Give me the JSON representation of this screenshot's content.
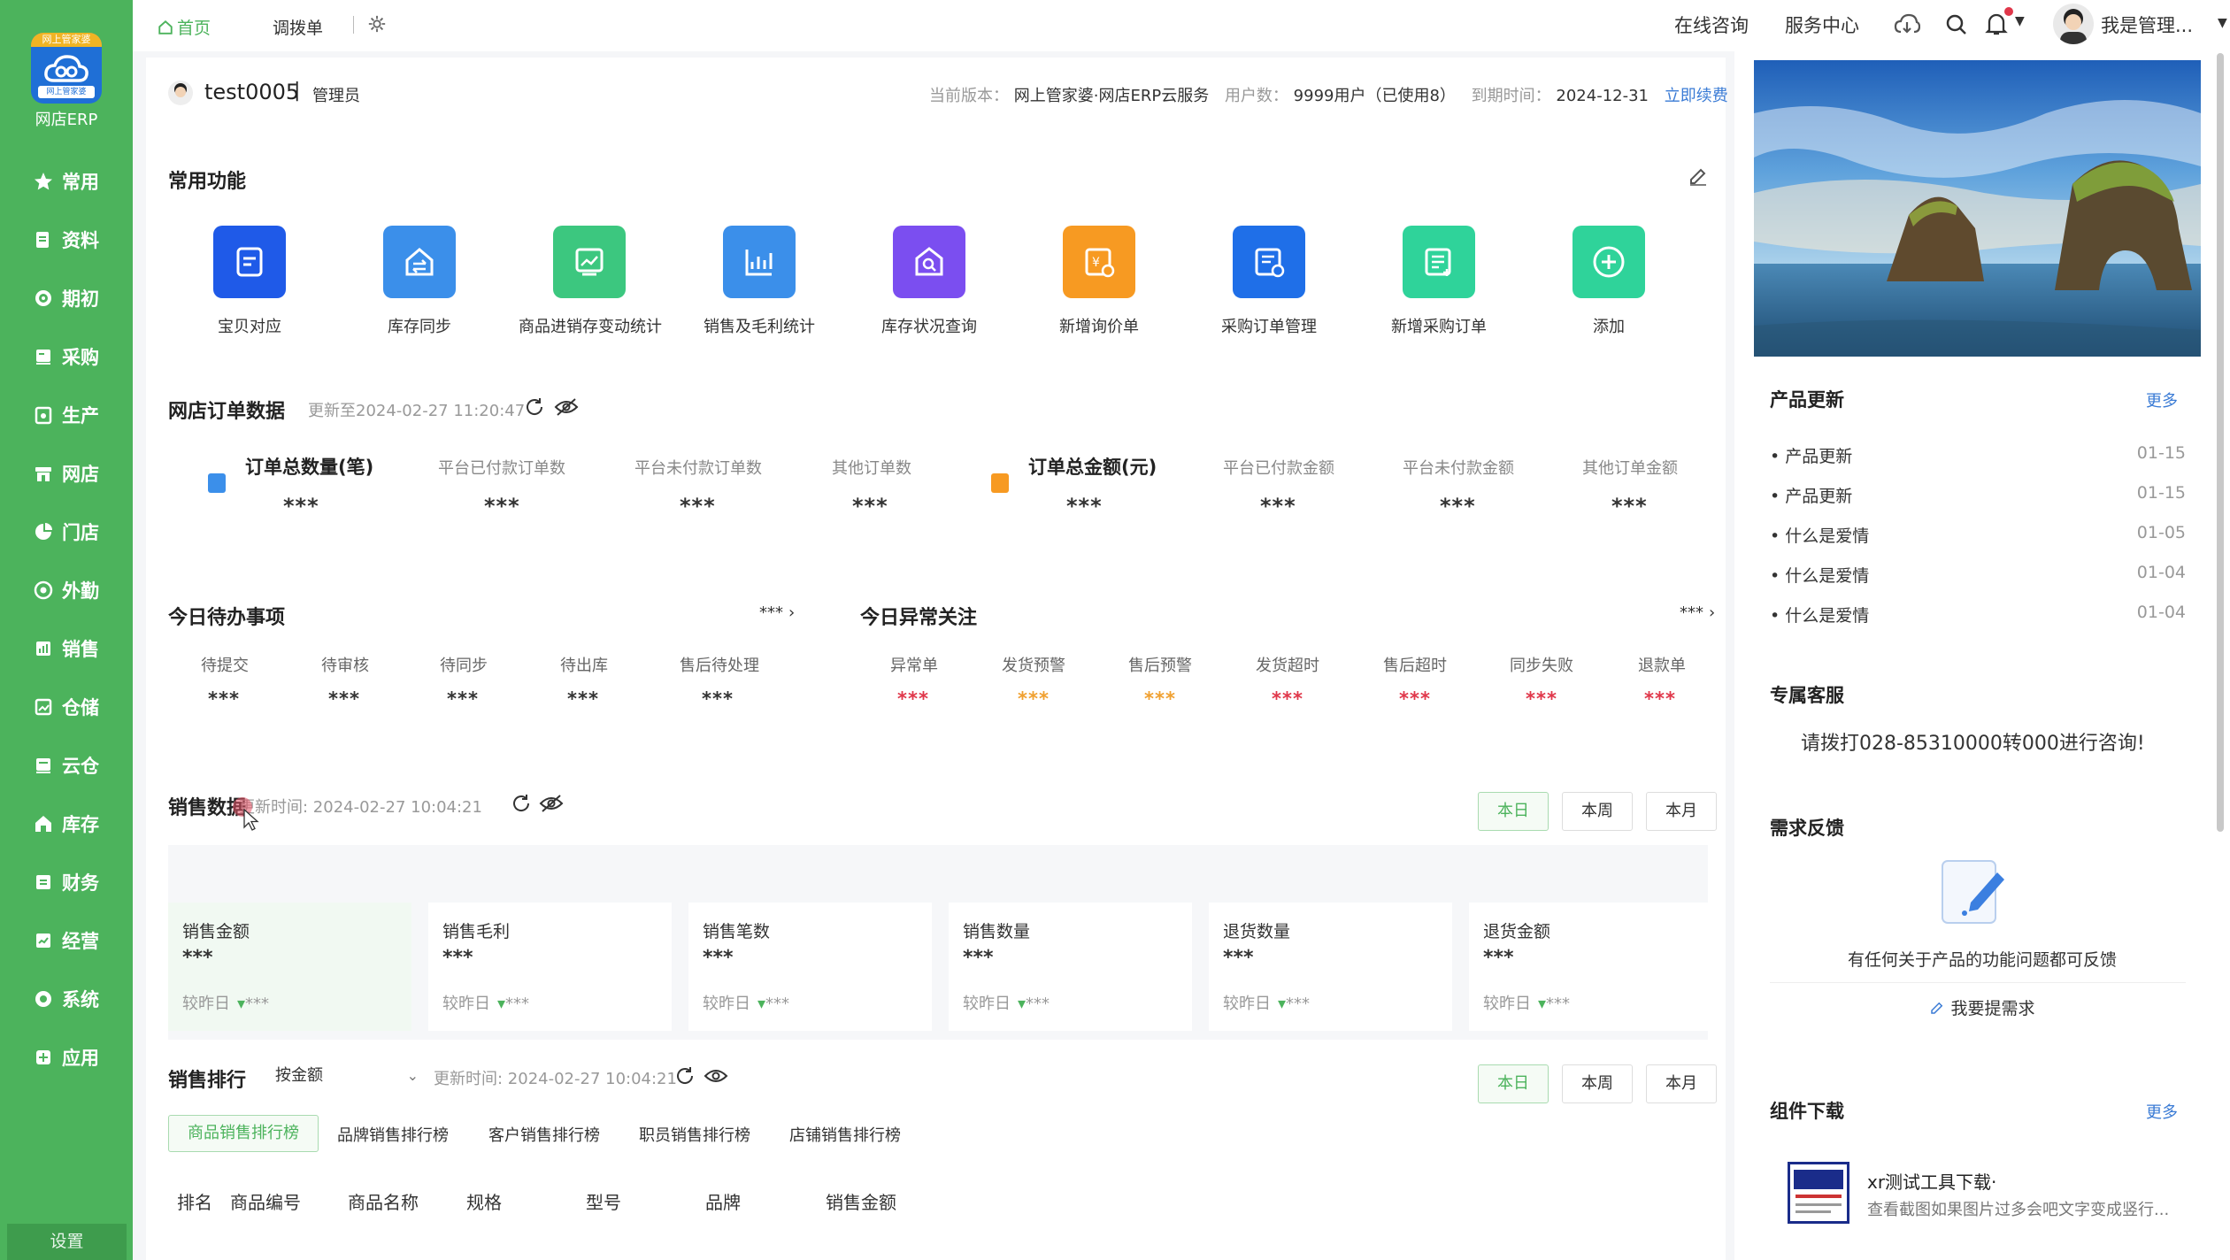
{
  "app": {
    "logo_ribbon": "网上管家婆",
    "logo_sub": "网上管家婆",
    "logo_text": "网店ERP",
    "settings": "设置"
  },
  "sidebar": {
    "items": [
      {
        "label": "常用",
        "icon": "star-icon"
      },
      {
        "label": "资料",
        "icon": "document-icon"
      },
      {
        "label": "期初",
        "icon": "target-icon"
      },
      {
        "label": "采购",
        "icon": "cart-icon"
      },
      {
        "label": "生产",
        "icon": "factory-icon"
      },
      {
        "label": "网店",
        "icon": "store-icon"
      },
      {
        "label": "门店",
        "icon": "shop-icon"
      },
      {
        "label": "外勤",
        "icon": "location-icon"
      },
      {
        "label": "销售",
        "icon": "sales-icon"
      },
      {
        "label": "仓储",
        "icon": "warehouse-icon"
      },
      {
        "label": "云仓",
        "icon": "cloud-warehouse-icon"
      },
      {
        "label": "库存",
        "icon": "inventory-icon"
      },
      {
        "label": "财务",
        "icon": "finance-icon"
      },
      {
        "label": "经营",
        "icon": "business-icon"
      },
      {
        "label": "系统",
        "icon": "system-icon"
      },
      {
        "label": "应用",
        "icon": "apps-icon"
      }
    ]
  },
  "topbar": {
    "tabs": [
      {
        "label": "首页"
      },
      {
        "label": "调拨单"
      }
    ],
    "online_consult": "在线咨询",
    "service_center": "服务中心",
    "user_name": "我是管理..."
  },
  "account": {
    "username": "test0005",
    "separator": "|",
    "role": "管理员",
    "version_label": "当前版本：",
    "version_value": "网上管家婆·网店ERP云服务",
    "users_label": "用户数：",
    "users_value": "9999用户（已使用8）",
    "expire_label": "到期时间：",
    "expire_value": "2024-12-31",
    "renew": "立即续费"
  },
  "common_functions": {
    "title": "常用功能",
    "items": [
      {
        "label": "宝贝对应",
        "color": "#1f5ae8"
      },
      {
        "label": "库存同步",
        "color": "#3b8fea"
      },
      {
        "label": "商品进销存变动统计",
        "color": "#3cc77f"
      },
      {
        "label": "销售及毛利统计",
        "color": "#3b8fea"
      },
      {
        "label": "库存状况查询",
        "color": "#7b4ef0"
      },
      {
        "label": "新增询价单",
        "color": "#f79a22"
      },
      {
        "label": "采购订单管理",
        "color": "#1f6fe8"
      },
      {
        "label": "新增采购订单",
        "color": "#2fd39a"
      },
      {
        "label": "添加",
        "color": "#2fd39a"
      }
    ]
  },
  "shop_orders": {
    "title": "网店订单数据",
    "updated": "更新至2024-02-27 11:20:47",
    "count_title": "订单总数量(笔)",
    "count_value": "***",
    "count_items": [
      {
        "label": "平台已付款订单数",
        "value": "***"
      },
      {
        "label": "平台未付款订单数",
        "value": "***"
      },
      {
        "label": "其他订单数",
        "value": "***"
      }
    ],
    "amount_title": "订单总金额(元)",
    "amount_value": "***",
    "amount_items": [
      {
        "label": "平台已付款金额",
        "value": "***"
      },
      {
        "label": "平台未付款金额",
        "value": "***"
      },
      {
        "label": "其他订单金额",
        "value": "***"
      }
    ]
  },
  "todo": {
    "title": "今日待办事项",
    "more": "***",
    "items": [
      {
        "label": "待提交",
        "value": "***"
      },
      {
        "label": "待审核",
        "value": "***"
      },
      {
        "label": "待同步",
        "value": "***"
      },
      {
        "label": "待出库",
        "value": "***"
      },
      {
        "label": "售后待处理",
        "value": "***"
      }
    ]
  },
  "anomalies": {
    "title": "今日异常关注",
    "more": "***",
    "items": [
      {
        "label": "异常单",
        "value": "***",
        "color": "#e0374a"
      },
      {
        "label": "发货预警",
        "value": "***",
        "color": "#f0a030"
      },
      {
        "label": "售后预警",
        "value": "***",
        "color": "#f0a030"
      },
      {
        "label": "发货超时",
        "value": "***",
        "color": "#e0374a"
      },
      {
        "label": "售后超时",
        "value": "***",
        "color": "#e0374a"
      },
      {
        "label": "同步失败",
        "value": "***",
        "color": "#e0374a"
      },
      {
        "label": "退款单",
        "value": "***",
        "color": "#e0374a"
      }
    ]
  },
  "sales": {
    "title": "销售数据",
    "updated": "更新时间: 2024-02-27 10:04:21",
    "periods": [
      "本日",
      "本周",
      "本月"
    ],
    "compare_label": "较昨日",
    "cards": [
      {
        "label": "销售金额",
        "value": "***",
        "delta": "***"
      },
      {
        "label": "销售毛利",
        "value": "***",
        "delta": "***"
      },
      {
        "label": "销售笔数",
        "value": "***",
        "delta": "***"
      },
      {
        "label": "销售数量",
        "value": "***",
        "delta": "***"
      },
      {
        "label": "退货数量",
        "value": "***",
        "delta": "***"
      },
      {
        "label": "退货金额",
        "value": "***",
        "delta": "***"
      }
    ]
  },
  "ranking": {
    "title": "销售排行",
    "sort_by": "按金额",
    "updated": "更新时间: 2024-02-27 10:04:21",
    "periods": [
      "本日",
      "本周",
      "本月"
    ],
    "tabs": [
      "商品销售排行榜",
      "品牌销售排行榜",
      "客户销售排行榜",
      "职员销售排行榜",
      "店铺销售排行榜"
    ],
    "columns": [
      "排名",
      "商品编号",
      "商品名称",
      "规格",
      "型号",
      "品牌",
      "销售金额"
    ]
  },
  "right_panel": {
    "product_updates": {
      "title": "产品更新",
      "more": "更多",
      "items": [
        {
          "text": "• 产品更新",
          "date": "01-15"
        },
        {
          "text": "• 产品更新",
          "date": "01-15"
        },
        {
          "text": "• 什么是爱情",
          "date": "01-05"
        },
        {
          "text": "• 什么是爱情",
          "date": "01-04"
        },
        {
          "text": "• 什么是爱情",
          "date": "01-04"
        }
      ]
    },
    "service": {
      "title": "专属客服",
      "text": "请拨打028-85310000转000进行咨询!"
    },
    "feedback": {
      "title": "需求反馈",
      "text": "有任何关于产品的功能问题都可反馈",
      "button": "我要提需求"
    },
    "downloads": {
      "title": "组件下载",
      "more": "更多",
      "item_title": "xr测试工具下载·",
      "item_desc": "查看截图如果图片过多会吧文字变成竖行..."
    }
  }
}
